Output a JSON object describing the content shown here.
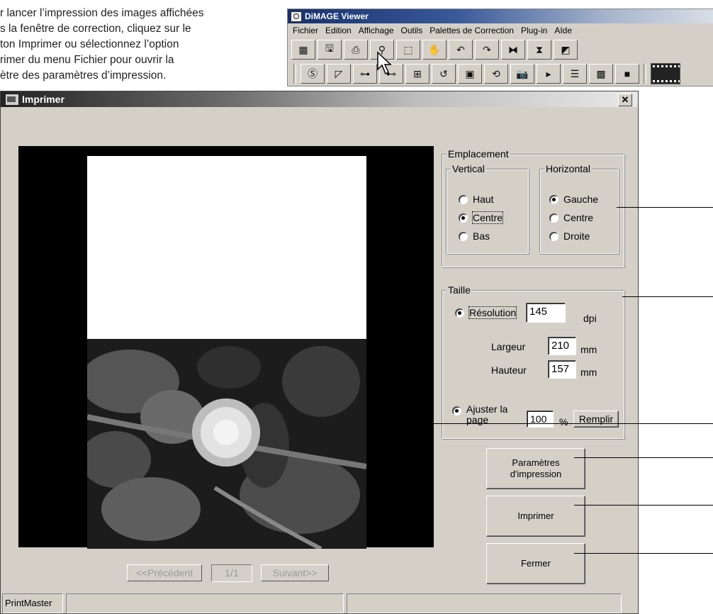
{
  "instructions": {
    "lines": [
      "r lancer l’impression des images affichées",
      "s la fenêtre de correction, cliquez sur le",
      "ton Imprimer ou sélectionnez l’option",
      "rimer du menu Fichier pour ouvrir la",
      "ètre des paramètres d’impression."
    ]
  },
  "viewer": {
    "title": "DiMAGE Viewer",
    "menu": [
      "Fichier",
      "Edition",
      "Affichage",
      "Outils",
      "Palettes de Correction",
      "Plug-in",
      "AIde"
    ]
  },
  "dialog": {
    "title": "Imprimer",
    "close_label": "✕",
    "emplacement": {
      "legend": "Emplacement",
      "vertical": {
        "legend": "Vertical",
        "options": [
          "Haut",
          "Centre",
          "Bas"
        ],
        "selected": "Centre"
      },
      "horizontal": {
        "legend": "Horizontal",
        "options": [
          "Gauche",
          "Centre",
          "Droite"
        ],
        "selected": "Gauche"
      }
    },
    "taille": {
      "legend": "Taille",
      "resolution_label": "Résolution",
      "resolution_value": "145",
      "resolution_unit": "dpi",
      "largeur_label": "Largeur",
      "largeur_value": "210",
      "hauteur_label": "Hauteur",
      "hauteur_value": "157",
      "mm_unit": "mm",
      "ajuster_label_1": "Ajuster la",
      "ajuster_label_2": "page",
      "ajuster_value": "100",
      "percent": "%",
      "remplir_label": "Remplir"
    },
    "buttons": {
      "parametres_1": "Paramètres",
      "parametres_2": "d'impression",
      "imprimer": "Imprimer",
      "fermer": "Fermer"
    },
    "nav": {
      "previous": "<<Précédent",
      "page": "1/1",
      "next": "Suivant>>"
    },
    "status": {
      "left": "PrintMaster",
      "middle": "",
      "right": ""
    }
  },
  "colors": {
    "dialog_bg": "#d4d0c8",
    "preview_bg": "#000000",
    "paper": "#ffffff"
  }
}
